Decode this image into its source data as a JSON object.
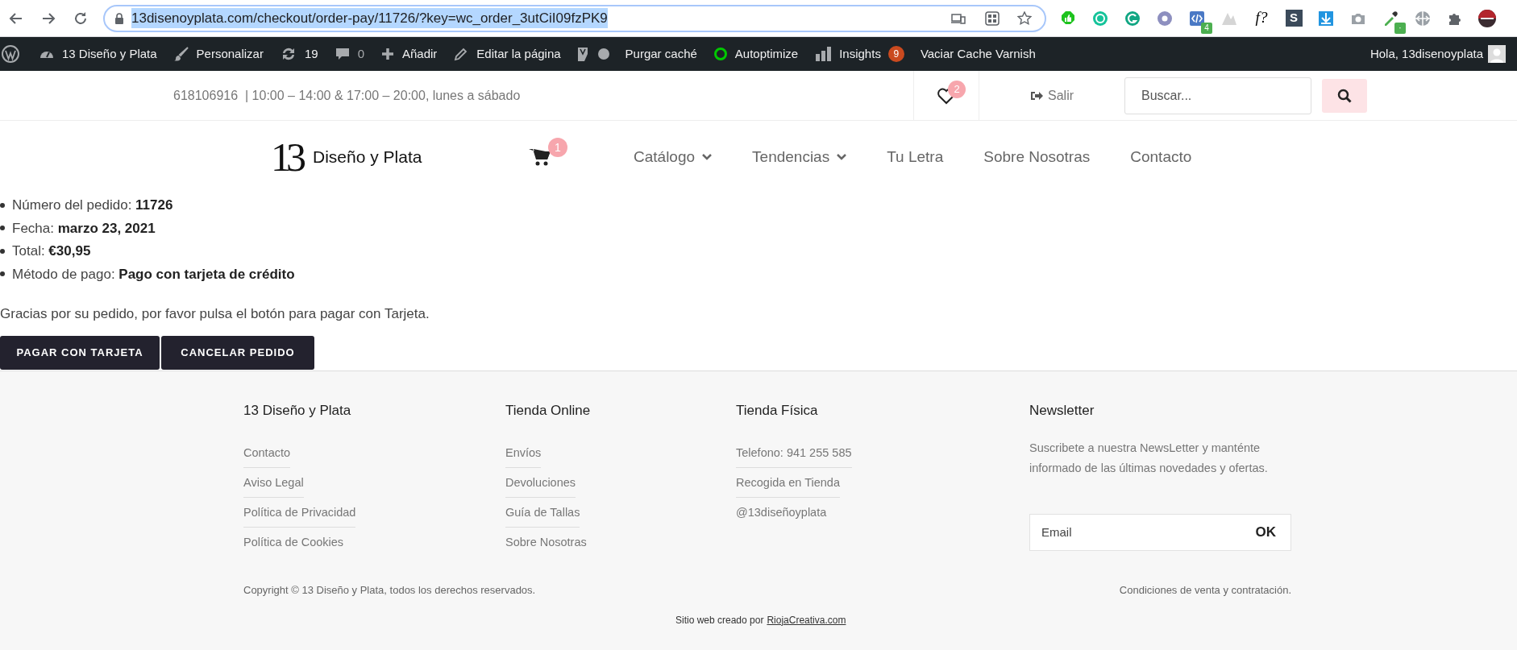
{
  "browser": {
    "url": "13disenoyplata.com/checkout/order-pay/11726/?key=wc_order_3utCiI09fzPK9",
    "url_selected": true,
    "extensions": [
      {
        "kind": "thumb"
      },
      {
        "kind": "ring"
      },
      {
        "kind": "grammar"
      },
      {
        "kind": "disc"
      },
      {
        "kind": "code",
        "badge": "4"
      },
      {
        "kind": "peaks"
      },
      {
        "kind": "text",
        "label": "f?"
      },
      {
        "kind": "letter",
        "label": "S"
      },
      {
        "kind": "download"
      },
      {
        "kind": "camera"
      },
      {
        "kind": "dropper",
        "badge": "·"
      },
      {
        "kind": "globe"
      },
      {
        "kind": "puzzle"
      },
      {
        "kind": "avatar"
      }
    ]
  },
  "admin_bar": {
    "items": [
      {
        "kind": "wordpress"
      },
      {
        "kind": "site",
        "label": "13 Diseño y Plata"
      },
      {
        "kind": "customize",
        "label": "Personalizar"
      },
      {
        "kind": "updates",
        "label": "19"
      },
      {
        "kind": "comments",
        "label": "0"
      },
      {
        "kind": "new",
        "label": "Añadir"
      },
      {
        "kind": "edit",
        "label": "Editar la página"
      },
      {
        "kind": "seo"
      },
      {
        "kind": "purge",
        "label": "Purgar caché"
      },
      {
        "kind": "autoptimize",
        "label": "Autoptimize"
      },
      {
        "kind": "insights",
        "label": "Insights",
        "badge": "9"
      },
      {
        "kind": "varnish",
        "label": "Vaciar Cache Varnish"
      }
    ],
    "greeting": "Hola, 13disenoyplata"
  },
  "top_bar": {
    "info": "618106916  | 10:00 – 14:00 & 17:00 – 20:00, lunes a sábado",
    "wishlist_count": "2",
    "logout": "Salir",
    "search": {
      "placeholder": "Buscar..."
    }
  },
  "header": {
    "logo": {
      "mark": "13",
      "name": "Diseño y Plata"
    },
    "cart_count": "1",
    "menu": [
      {
        "label": "Catálogo",
        "dropdown": true
      },
      {
        "label": "Tendencias",
        "dropdown": true
      },
      {
        "label": "Tu Letra",
        "dropdown": false
      },
      {
        "label": "Sobre Nosotras",
        "dropdown": false
      },
      {
        "label": "Contacto",
        "dropdown": false
      }
    ]
  },
  "order": {
    "details": [
      "Número del pedido: **11726**",
      "Fecha: **marzo 23, 2021**",
      "Total: **€30,95**",
      "Método de pago: **Pago con tarjeta de crédito**"
    ],
    "message": "Gracias por su pedido, por favor pulsa el botón para pagar con Tarjeta.",
    "buttons": [
      "PAGAR CON TARJETA",
      "CANCELAR PEDIDO"
    ]
  },
  "footer": {
    "columns": [
      {
        "title": "13 Diseño y Plata",
        "links": [
          "Contacto",
          "Aviso Legal",
          "Política de Privacidad",
          "Política de Cookies"
        ]
      },
      {
        "title": "Tienda Online",
        "links": [
          "Envíos",
          "Devoluciones",
          "Guía de Tallas",
          "Sobre Nosotras"
        ]
      },
      {
        "title": "Tienda Física",
        "links": [
          "Telefono: 941 255 585",
          "Recogida en Tienda",
          "@13diseñoyplata"
        ]
      }
    ],
    "newsletter": {
      "title": "Newsletter",
      "text": "Suscribete a nuestra NewsLetter y manténte informado de las últimas novedades y ofertas.",
      "placeholder": "Email",
      "button": "OK"
    },
    "copyright": "Copyright © 13 Diseño y Plata, todos los derechos reservados.",
    "terms": "Condiciones de venta y contratación.",
    "credit": {
      "text": "Sitio web creado por",
      "link": "RiojaCreativa.com"
    }
  }
}
